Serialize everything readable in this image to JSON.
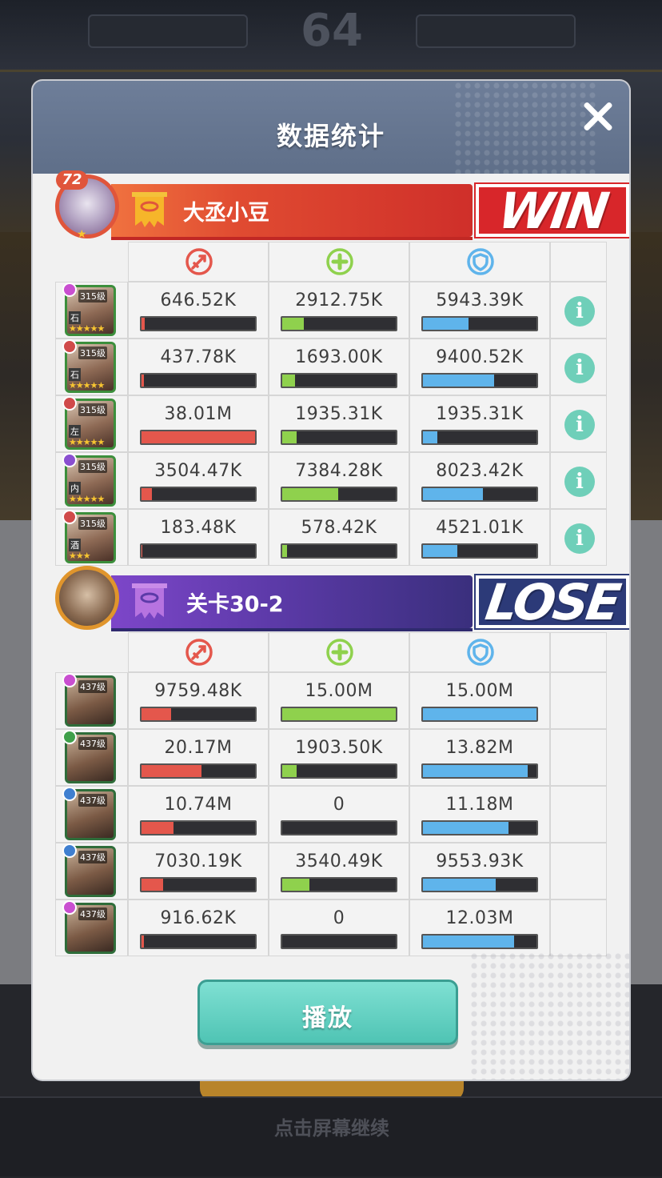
{
  "modal": {
    "title": "数据统计",
    "play_label": "播放"
  },
  "background": {
    "score": "64",
    "bottom_hint": "点击屏幕继续"
  },
  "player_team": {
    "name": "大丞小豆",
    "level": "72",
    "result": "WIN",
    "result_color": "#d8262a",
    "heroes": [
      {
        "level": "315级",
        "tag": "石",
        "stars": "★★★★★",
        "gem_color": "#c94fd0",
        "damage": "646.52K",
        "damage_pct": 3,
        "heal": "2912.75K",
        "heal_pct": 19,
        "tank": "5943.39K",
        "tank_pct": 40
      },
      {
        "level": "315级",
        "tag": "石",
        "stars": "★★★★★",
        "gem_color": "#d04a4a",
        "damage": "437.78K",
        "damage_pct": 2,
        "heal": "1693.00K",
        "heal_pct": 11,
        "tank": "9400.52K",
        "tank_pct": 63
      },
      {
        "level": "315级",
        "tag": "左",
        "stars": "★★★★★",
        "gem_color": "#d04a4a",
        "damage": "38.01M",
        "damage_pct": 100,
        "heal": "1935.31K",
        "heal_pct": 13,
        "tank": "1935.31K",
        "tank_pct": 13
      },
      {
        "level": "315级",
        "tag": "内",
        "stars": "★★★★★",
        "gem_color": "#8a4fd0",
        "damage": "3504.47K",
        "damage_pct": 9,
        "heal": "7384.28K",
        "heal_pct": 49,
        "tank": "8023.42K",
        "tank_pct": 53
      },
      {
        "level": "315级",
        "tag": "酒",
        "stars": "★★★",
        "gem_color": "#d04a4a",
        "damage": "183.48K",
        "damage_pct": 1,
        "heal": "578.42K",
        "heal_pct": 4,
        "tank": "4521.01K",
        "tank_pct": 30
      }
    ]
  },
  "enemy_team": {
    "name": "关卡30-2",
    "result": "LOSE",
    "result_color": "#2c3a78",
    "heroes": [
      {
        "level": "437级",
        "gem_color": "#c94fd0",
        "damage": "9759.48K",
        "damage_pct": 26,
        "heal": "15.00M",
        "heal_pct": 100,
        "tank": "15.00M",
        "tank_pct": 100
      },
      {
        "level": "437级",
        "gem_color": "#3fa04a",
        "damage": "20.17M",
        "damage_pct": 53,
        "heal": "1903.50K",
        "heal_pct": 13,
        "tank": "13.82M",
        "tank_pct": 92
      },
      {
        "level": "437级",
        "gem_color": "#3f7fd0",
        "damage": "10.74M",
        "damage_pct": 28,
        "heal": "0",
        "heal_pct": 0,
        "tank": "11.18M",
        "tank_pct": 75
      },
      {
        "level": "437级",
        "gem_color": "#3f7fd0",
        "damage": "7030.19K",
        "damage_pct": 19,
        "heal": "3540.49K",
        "heal_pct": 24,
        "tank": "9553.93K",
        "tank_pct": 64
      },
      {
        "level": "437级",
        "gem_color": "#c94fd0",
        "damage": "916.62K",
        "damage_pct": 2,
        "heal": "0",
        "heal_pct": 0,
        "tank": "12.03M",
        "tank_pct": 80
      }
    ]
  },
  "stat_columns": [
    {
      "icon": "sword-icon",
      "color": "#e4574c"
    },
    {
      "icon": "heal-cross-icon",
      "color": "#8fd14d"
    },
    {
      "icon": "shield-icon",
      "color": "#5fb4eb"
    }
  ]
}
